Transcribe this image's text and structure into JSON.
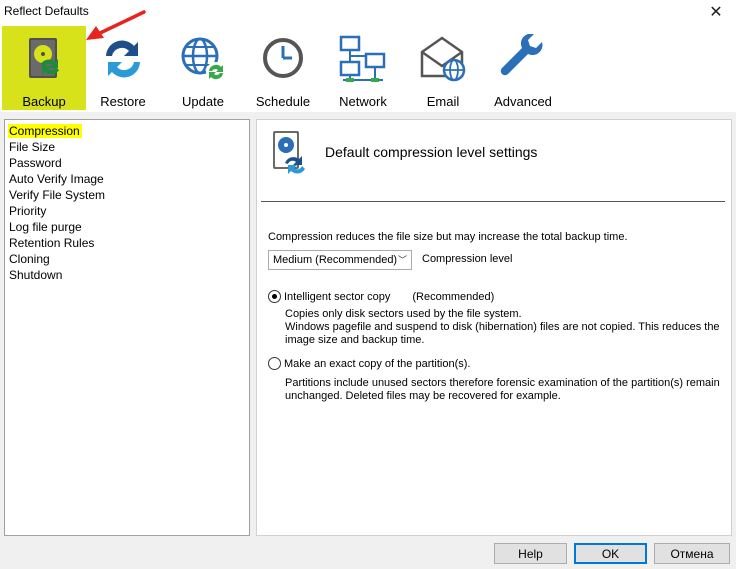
{
  "window": {
    "title": "Reflect Defaults"
  },
  "toolbar": {
    "items": [
      {
        "label": "Backup",
        "icon": "backup-disk-icon",
        "active": true
      },
      {
        "label": "Restore",
        "icon": "restore-arrows-icon"
      },
      {
        "label": "Update",
        "icon": "update-globe-icon"
      },
      {
        "label": "Schedule",
        "icon": "clock-icon"
      },
      {
        "label": "Network",
        "icon": "network-computers-icon"
      },
      {
        "label": "Email",
        "icon": "envelope-globe-icon"
      },
      {
        "label": "Advanced",
        "icon": "wrench-icon"
      }
    ]
  },
  "sidebar": {
    "items": [
      {
        "label": "Compression",
        "selected": true
      },
      {
        "label": "File Size"
      },
      {
        "label": "Password"
      },
      {
        "label": "Auto Verify Image"
      },
      {
        "label": "Verify File System"
      },
      {
        "label": "Priority"
      },
      {
        "label": "Log file purge"
      },
      {
        "label": "Retention Rules"
      },
      {
        "label": "Cloning"
      },
      {
        "label": "Shutdown"
      }
    ]
  },
  "main": {
    "heading": "Default compression level settings",
    "description": "Compression reduces the file size but may increase the total backup time.",
    "compression_select": {
      "value": "Medium (Recommended)",
      "label": "Compression level"
    },
    "options": [
      {
        "label": "Intelligent sector copy",
        "extra": "(Recommended)",
        "checked": true,
        "lines": [
          "Copies only disk sectors used by the file system.",
          "Windows pagefile and suspend to disk (hibernation) files are not copied. This reduces the image size and backup time."
        ]
      },
      {
        "label": "Make an exact copy of the partition(s).",
        "checked": false,
        "lines": [
          "Partitions include unused sectors therefore forensic examination of the partition(s) remain unchanged. Deleted files may be recovered for example."
        ]
      }
    ]
  },
  "buttons": {
    "help": "Help",
    "ok": "OK",
    "cancel": "Отмена"
  },
  "colors": {
    "active_tab": "#d7e21a",
    "highlight": "#ffff00",
    "annotation_arrow": "#e8231f",
    "icon_blue": "#2a6fb8"
  }
}
